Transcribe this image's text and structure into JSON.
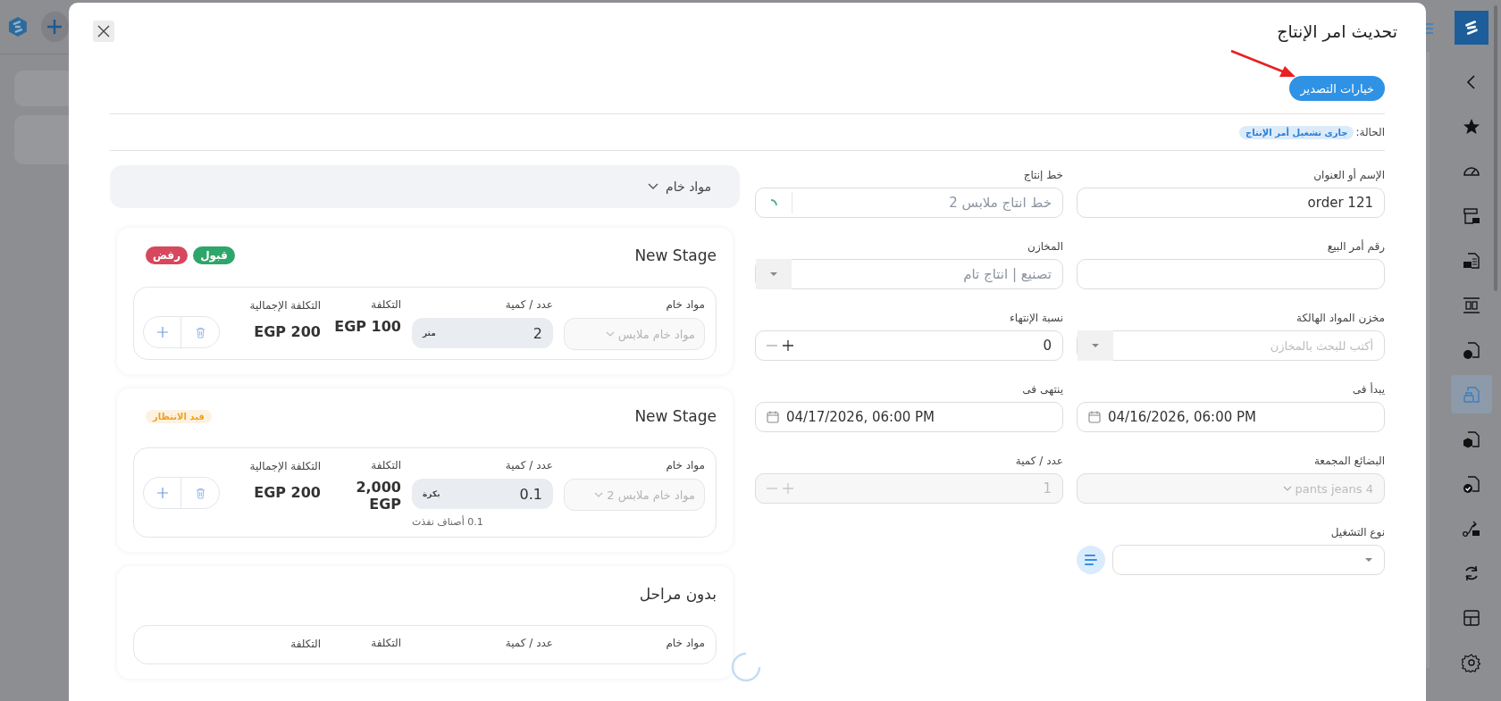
{
  "modal": {
    "title": "تحديث امر الإنتاج",
    "export_button": "خيارات التصدير",
    "status": {
      "label": "الحالة:",
      "value": "جارى تشغيل أمر الإنتاج"
    }
  },
  "form": {
    "fields": [
      {
        "kind": "text",
        "label": "الإسم أو العنوان",
        "value": "order 121"
      },
      {
        "kind": "select",
        "label": "خط إنتاج",
        "value": "خط انتاج ملابس 2",
        "loading": true
      },
      {
        "kind": "text",
        "label": "رقم أمر البيع"
      },
      {
        "kind": "select",
        "label": "المخازن",
        "value": "تصنيع | انتاج تام",
        "loading": false
      },
      {
        "kind": "select",
        "label": "مخزن المواد الهالكة",
        "placeholder": "أكتب للبحث بالمخازن",
        "loading": false
      },
      {
        "kind": "stepper",
        "label": "نسبة الإنتهاء",
        "value": "0",
        "disabled": false
      },
      {
        "kind": "date",
        "label": "يبدأ فى",
        "value": "04/16/2026, 06:00 PM"
      },
      {
        "kind": "date",
        "label": "ينتهى فى",
        "value": "04/17/2026, 06:00 PM"
      },
      {
        "kind": "dropdown",
        "label": "البضائع المجمعة",
        "value": "pants jeans 4",
        "disabled": true
      },
      {
        "kind": "stepper",
        "label": "عدد / كمية",
        "value": "1",
        "disabled": true
      },
      {
        "kind": "operation",
        "label": "نوع التشغيل"
      }
    ]
  },
  "materials": {
    "header": "مواد خام",
    "stages": [
      {
        "title": "New Stage",
        "badges": [
          {
            "label": "قبول",
            "kind": "solid",
            "color": "#2ea56a"
          },
          {
            "label": "رفض",
            "kind": "solid",
            "color": "#d7475e"
          }
        ],
        "rows": [
          {
            "material_label": "مواد خام",
            "material": "مواد خام ملابس",
            "qty_label": "عدد / كمية",
            "qty": "2",
            "unit": "متر",
            "cost_label": "التكلفة",
            "cost": "EGP 100",
            "total_label": "التكلفة الإجمالية",
            "total": "EGP 200"
          }
        ]
      },
      {
        "title": "New Stage",
        "badges": [
          {
            "label": "قيد الانتظار",
            "kind": "soft",
            "color": "#f0a020"
          }
        ],
        "rows": [
          {
            "material_label": "مواد خام",
            "material": "مواد خام ملابس 2",
            "qty_label": "عدد / كمية",
            "qty": "0.1",
            "unit": "بكرة",
            "note": "0.1 أصناف نفذت",
            "cost_label": "التكلفة",
            "cost": "2,000 EGP",
            "total_label": "التكلفة الإجمالية",
            "total": "EGP 200"
          }
        ]
      },
      {
        "title": "بدون مراحل",
        "rows": [
          {
            "material_label": "مواد خام",
            "qty_label": "عدد / كمية",
            "cost_label": "التكلفة",
            "total_label": "التكلفة"
          }
        ]
      }
    ]
  },
  "sidebar": {
    "items": [
      {
        "selected": false
      },
      {
        "selected": false
      },
      {
        "selected": false
      },
      {
        "selected": false
      },
      {
        "selected": false
      },
      {
        "selected": false
      },
      {
        "selected": false
      },
      {
        "selected": true
      },
      {
        "selected": false
      },
      {
        "selected": false
      },
      {
        "selected": false
      },
      {
        "selected": false
      },
      {
        "selected": false
      },
      {
        "selected": false
      }
    ]
  }
}
